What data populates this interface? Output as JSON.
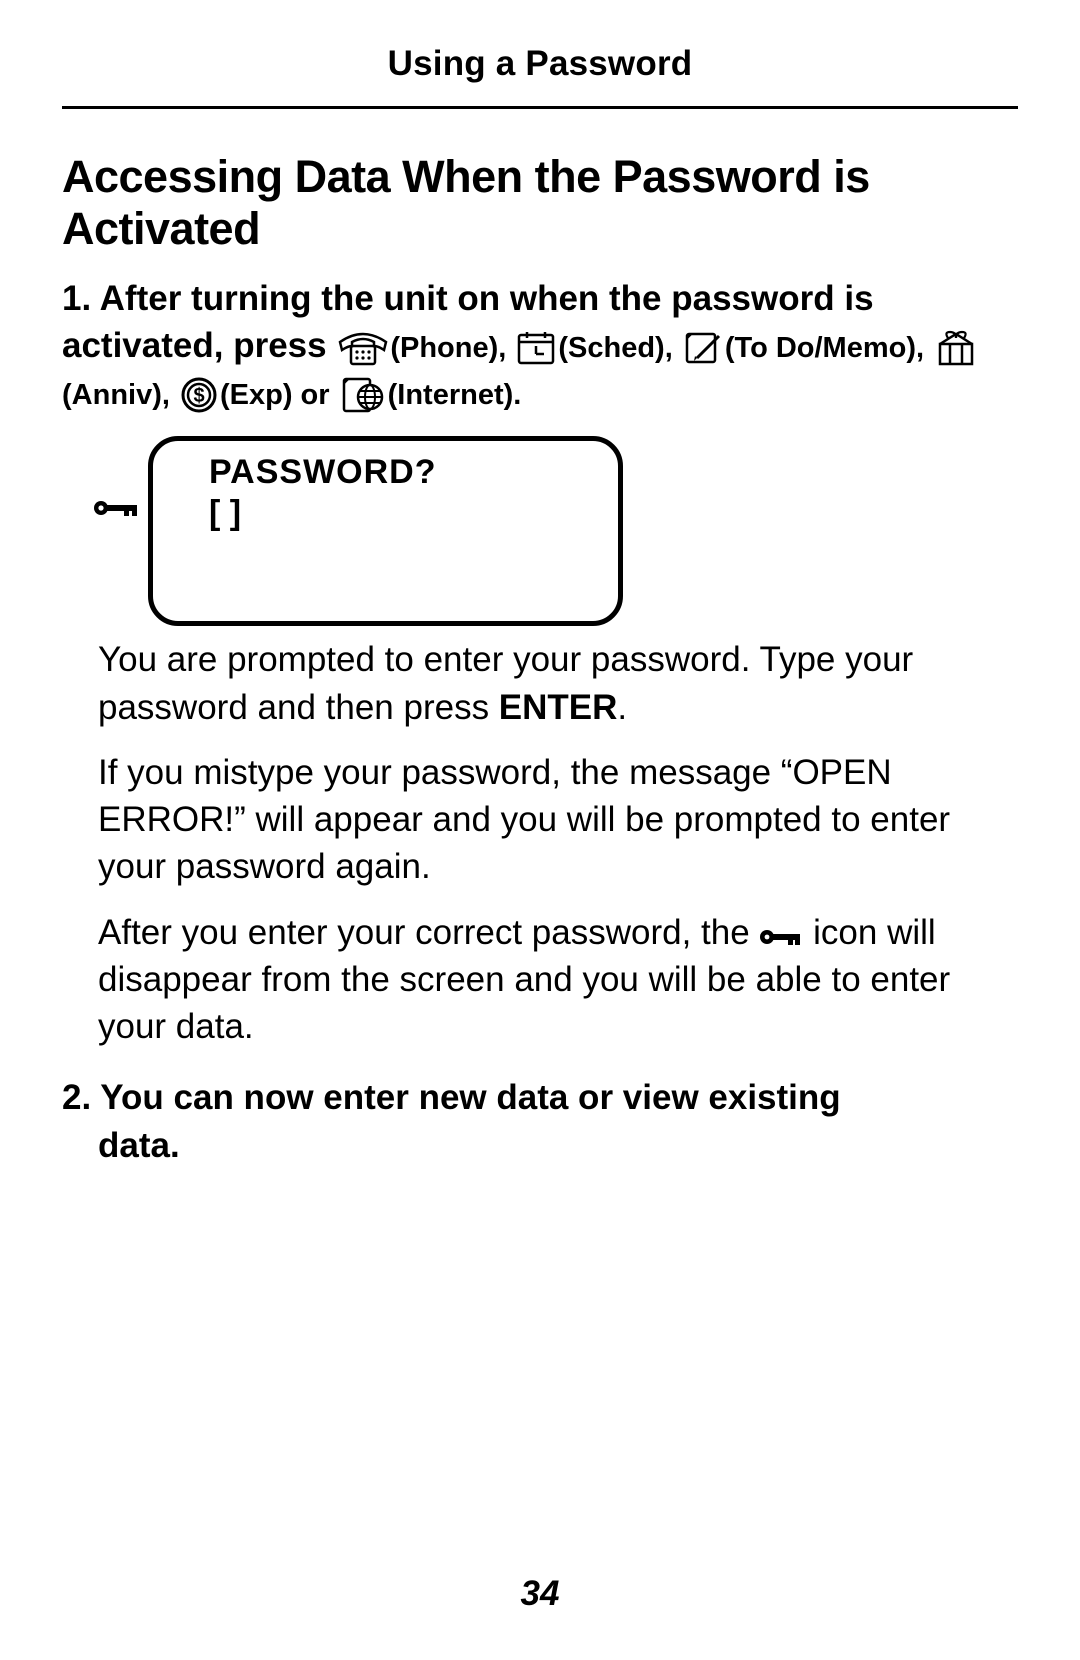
{
  "header": {
    "title": "Using a Password"
  },
  "heading": "Accessing Data When the Password is Activated",
  "step1": {
    "number": "1.",
    "lead": "After turning the unit on when the password is activated,  press ",
    "labels": {
      "phone": "(Phone)",
      "sched": "(Sched)",
      "todo": "(To Do/Memo)",
      "anniv": "(Anniv)",
      "exp": "(Exp)",
      "internet": "(Internet)"
    },
    "sep_comma": ", ",
    "sep_or": " or ",
    "period": "."
  },
  "lcd": {
    "line1": "PASSWORD?",
    "line2": "[              ]"
  },
  "para1_a": "You are prompted to enter your password. Type your password and then press ",
  "para1_enter": "ENTER",
  "para1_b": ".",
  "para2": "If you mistype your password, the message “OPEN ERROR!” will appear and you will be prompted to enter your password again.",
  "para3_a": "After you enter your correct password, the ",
  "para3_b": " icon will disappear from the screen and you will be able to enter your data.",
  "step2": {
    "number": "2.",
    "text": "You can now enter new data or view existing data."
  },
  "page_number": "34"
}
